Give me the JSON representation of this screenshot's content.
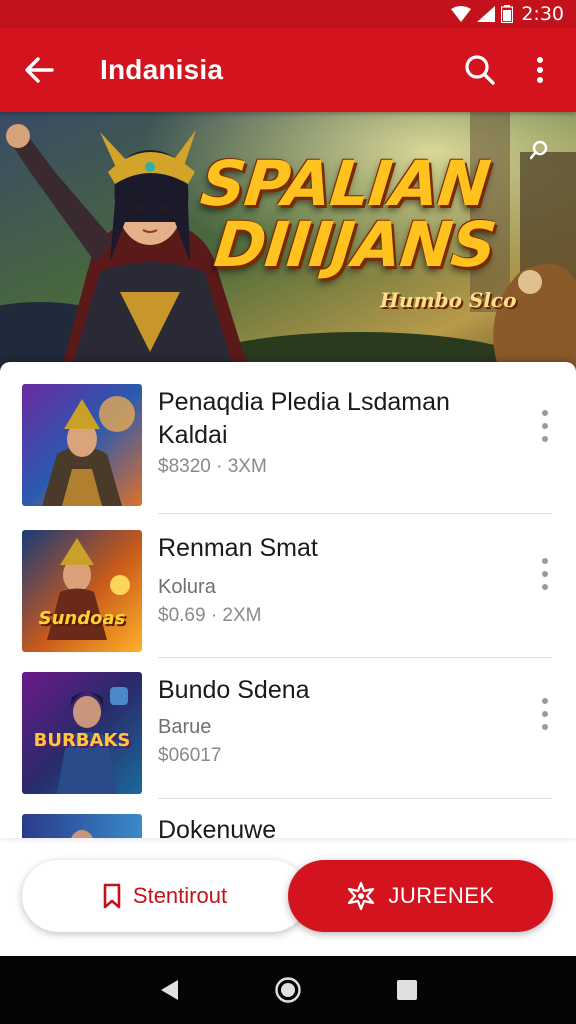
{
  "status_bar": {
    "time": "2:30"
  },
  "app_bar": {
    "title": "Indanisia"
  },
  "banner": {
    "title_line1": "SPALIAN",
    "title_line2": "DIIIJANS",
    "subtitle": "Humbo Slco"
  },
  "items": [
    {
      "title": "Penaqdia Pledia Lsdaman Kaldai",
      "subtitle": "",
      "price": "$8320 · 3XM"
    },
    {
      "title": "Renman Smat",
      "subtitle": "Kolura",
      "price": "$0.69 · 2XM"
    },
    {
      "title": "Bundo Sdena",
      "subtitle": "Barue",
      "price": "$06017"
    },
    {
      "title": "Dokenuwe",
      "subtitle": "",
      "price": ""
    }
  ],
  "thumb_labels": {
    "item2": "Sundoas",
    "item3": "BURBAKS"
  },
  "buttons": {
    "outline_label": "Stentirout",
    "filled_label": "JURENEK"
  },
  "colors": {
    "primary": "#d3141f",
    "status_bar": "#c4121c",
    "nav_bar": "#050505"
  }
}
